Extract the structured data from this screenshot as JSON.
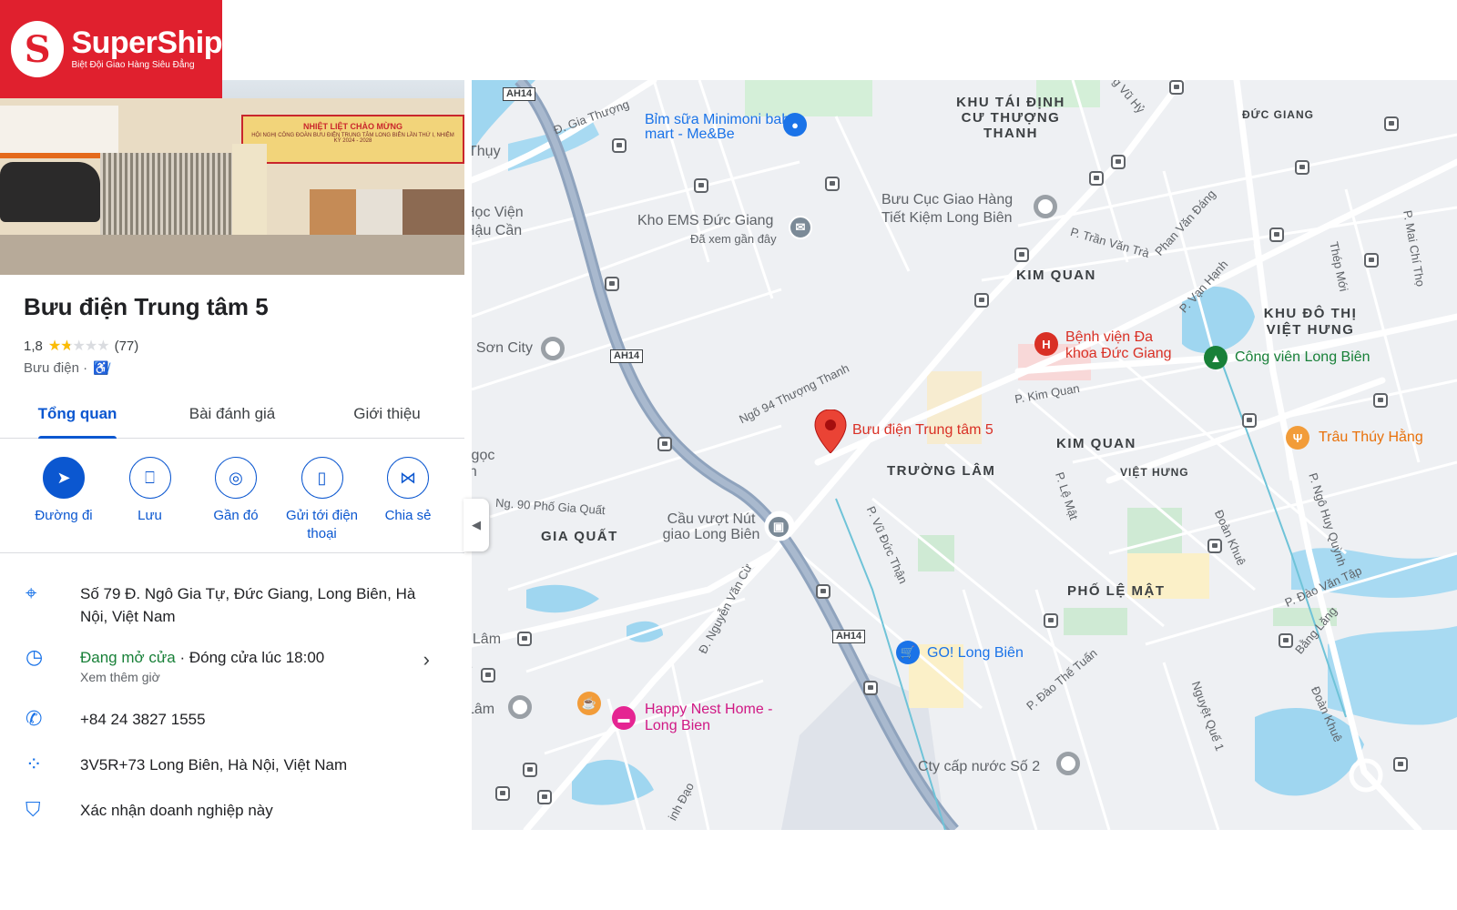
{
  "logo": {
    "mark": "S",
    "name": "SuperShip",
    "tagline": "Biệt Đội Giao Hàng Siêu Đẳng"
  },
  "photo": {
    "banner_title": "NHIỆT LIỆT CHÀO MỪNG",
    "banner_sub": "HỘI NGHỊ CÔNG ĐOÀN BƯU ĐIỆN TRUNG TÂM LONG BIÊN LẦN THỨ I, NHIỆM KỲ 2024 - 2028"
  },
  "place": {
    "title": "Bưu điện Trung tâm 5",
    "rating_value": "1,8",
    "rating_fraction": 0.36,
    "stars": "★★★★★",
    "review_count": "(77)",
    "category": "Bưu điện ·"
  },
  "tabs": [
    {
      "label": "Tổng quan",
      "active": true
    },
    {
      "label": "Bài đánh giá",
      "active": false
    },
    {
      "label": "Giới thiệu",
      "active": false
    }
  ],
  "actions": [
    {
      "label": "Đường đi",
      "icon": "directions-icon"
    },
    {
      "label": "Lưu",
      "icon": "bookmark-icon"
    },
    {
      "label": "Gần đó",
      "icon": "nearby-icon"
    },
    {
      "label": "Gửi tới điện thoại",
      "icon": "send-to-phone-icon"
    },
    {
      "label": "Chia sẻ",
      "icon": "share-icon"
    }
  ],
  "info": {
    "address": "Số 79 Đ. Ngô Gia Tự, Đức Giang, Long Biên, Hà Nội, Việt Nam",
    "hours_status": "Đang mở cửa",
    "hours_close": " · Đóng cửa lúc 18:00",
    "hours_more": "Xem thêm giờ",
    "phone": "+84 24 3827 1555",
    "plus_code": "3V5R+73 Long Biên, Hà Nội, Việt Nam",
    "claim": "Xác nhận doanh nghiệp này"
  },
  "map": {
    "pin_label": "Bưu điện Trung tâm 5",
    "areas": [
      "KHU TÁI ĐỊNH CƯ THƯỢNG THANH",
      "KIM QUAN",
      "KIM QUAN",
      "KHU ĐÔ THỊ VIỆT HƯNG",
      "TRƯỜNG LÂM",
      "GIA QUẤT",
      "PHỐ LỆ MẬT",
      "ĐỨC GIANG",
      "VIỆT HƯNG"
    ],
    "pois": {
      "minimoni": "Bỉm sữa Minimoni baby mart - Me&Be",
      "ems": "Kho EMS Đức Giang",
      "ems_sub": "Đã xem gần đây",
      "giaohang": "Bưu Cục Giao Hàng Tiết Kiệm Long Biên",
      "hospital": "Bệnh viện Đa khoa Đức Giang",
      "park": "Công viên Long Biên",
      "trau": "Trâu Thúy Hằng",
      "cauvuot": "Cầu vượt Nút giao Long Biên",
      "go": "GO! Long Biên",
      "happynest": "Happy Nest Home - Long Bien",
      "capnuoc": "Cty cấp nước Số 2",
      "hocvien": "Học Viện Hậu Cần",
      "soncity": "ai Sơn City",
      "thuy": "Thụy",
      "ngoc": "Ngọc ên",
      "ialam": "ia Lâm",
      "lam": "Lâm",
      "e": "e n"
    },
    "streets": {
      "giathuong": "Đ. Gia Thượng",
      "ngo94": "Ngõ 94 Thượng Thanh",
      "kimquan": "P. Kim Quan",
      "tranvantra": "P. Trần Văn Trà",
      "phanvandang": "Phan Văn Đáng",
      "vanhanh": "P. Vạn Hạnh",
      "ng90": "Ng. 90 Phố Gia Quất",
      "nguyenvancu": "Đ. Nguyễn Văn Cừ",
      "vuducthan": "P. Vũ Đức Thận",
      "lemat": "P. Lệ Mật",
      "daothetuan": "P. Đào Thế Tuấn",
      "nguyetque": "Nguyệt Quế 1",
      "doankhue": "Đoàn Khuê",
      "doankhue2": "Đoàn Khuê",
      "daovantap": "P. Đào Văn Tập",
      "banglang": "Bằng Lăng",
      "ngohuyquynh": "P. Ngô Huy Quỳnh",
      "thepmoi": "Thép Mới",
      "maichitho": "P. Mai Chí Thọ",
      "vuhy": "g Vũ Hỷ",
      "minhdao": "inh Đạo"
    },
    "shields": [
      "AH14",
      "AH14",
      "AH14"
    ]
  }
}
